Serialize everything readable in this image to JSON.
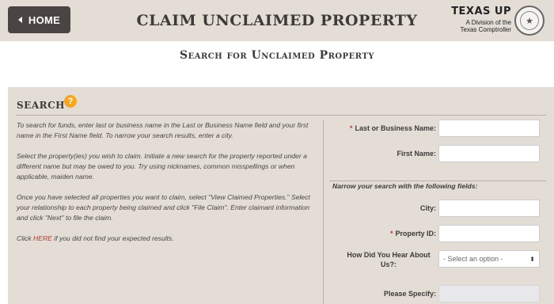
{
  "header": {
    "home_label": "HOME",
    "title": "CLAIM UNCLAIMED PROPERTY",
    "logo_main": "TEXAS UP",
    "logo_sub_1": "A Division of the",
    "logo_sub_2": "Texas Comptroller"
  },
  "subtitle": "Search for Unclaimed Property",
  "search": {
    "heading": "SEARCH",
    "help_icon": "?",
    "p1": "To search for funds, enter last or business name in the Last or Business Name field and your first name in the First Name field. To narrow your search results, enter a city.",
    "p2": "Select the property(ies) you wish to claim. Initiate a new search for the property reported under a different name but may be owed to you. Try using nicknames, common misspellings or when applicable, maiden name.",
    "p3": "Once you have selected all properties you want to claim, select \"View Claimed Properties.\" Select your relationship to each property being claimed and click \"File Claim\". Enter claimant information and click \"Next\" to file the claim.",
    "p4_pre": "Click ",
    "p4_link": "HERE",
    "p4_post": " if you did not find your expected results."
  },
  "form": {
    "last_name_label": "Last or Business Name:",
    "first_name_label": "First Name:",
    "narrow_label": "Narrow your search with the following fields:",
    "city_label": "City:",
    "property_id_label": "Property ID:",
    "hear_label": "How Did You Hear About Us?:",
    "hear_selected": "- Select an option -",
    "specify_label": "Please Specify:",
    "required_mark": "*"
  }
}
